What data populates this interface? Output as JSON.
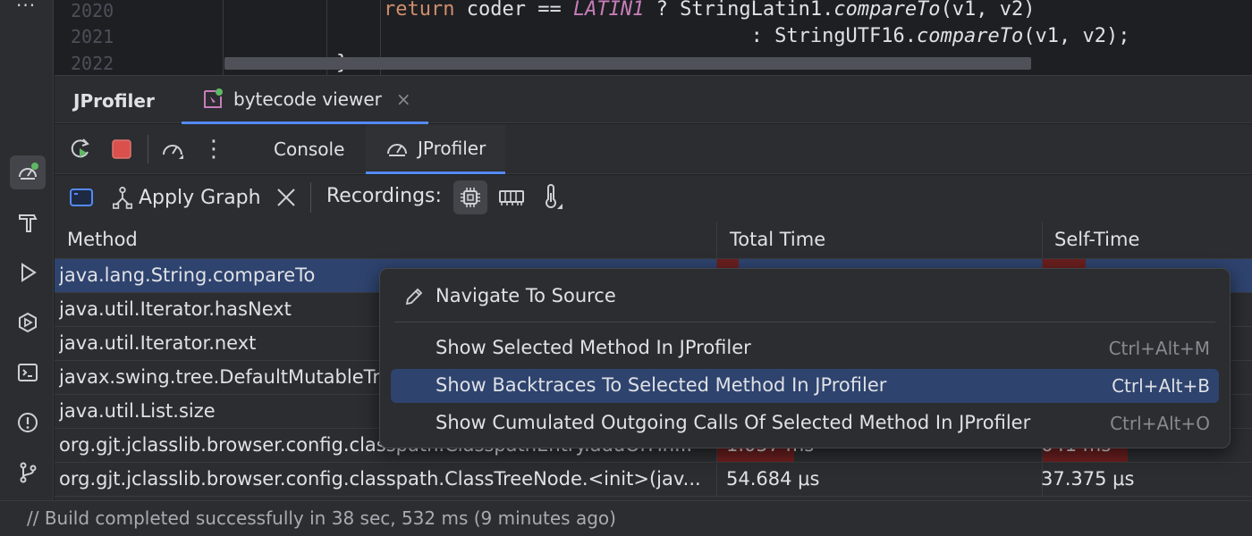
{
  "editor": {
    "lines": [
      {
        "number": "2020",
        "indent": "        ",
        "keyword": "return",
        "rest1": " coder == ",
        "const": "LATIN1",
        "rest2": " ? StringLatin1.",
        "fn": "compareTo",
        "rest3": "(v1, v2)"
      },
      {
        "number": "2021",
        "rest1": "                               : StringUTF16.",
        "fn": "compareTo",
        "rest3": "(v1, v2);"
      },
      {
        "number": "2022",
        "rest1": "    }"
      }
    ]
  },
  "tool_window": {
    "title": "JProfiler",
    "tab_label": "bytecode viewer",
    "tab_close": "×"
  },
  "inner_toolbar": {
    "more": "⋮",
    "tabs": [
      {
        "label": "Console"
      },
      {
        "label": "JProfiler"
      }
    ]
  },
  "profiler_toolbar": {
    "apply_graph": "Apply Graph",
    "recordings_label": "Recordings:"
  },
  "table": {
    "columns": [
      "Method",
      "Total Time",
      "Self-Time"
    ],
    "rows": [
      {
        "method": "java.lang.String.compareTo",
        "total": "",
        "self": "",
        "total_fill": 0.07,
        "self_fill": 0.21
      },
      {
        "method": "java.util.Iterator.hasNext",
        "total": "",
        "self": "",
        "total_fill": 0,
        "self_fill": 0
      },
      {
        "method": "java.util.Iterator.next",
        "total": "",
        "self": "",
        "total_fill": 0,
        "self_fill": 0
      },
      {
        "method": "javax.swing.tree.DefaultMutableTr",
        "total": "",
        "self": "",
        "total_fill": 0,
        "self_fill": 0
      },
      {
        "method": "java.util.List.size",
        "total": "",
        "self": "",
        "total_fill": 0,
        "self_fill": 0
      },
      {
        "method": "org.gjt.jclasslib.browser.config.classpath.ClasspathEntry.addOrFin...",
        "total": "1.057 ms",
        "self": "641 ms",
        "total_fill": 0.24,
        "self_fill": 0.41
      },
      {
        "method": "org.gjt.jclasslib.browser.config.classpath.ClassTreeNode.<init>(jav...",
        "total": "54.684 μs",
        "self": "37.375 μs",
        "total_fill": 0,
        "self_fill": 0
      }
    ]
  },
  "context_menu": {
    "items": [
      {
        "label": "Navigate To Source",
        "shortcut": ""
      },
      {
        "label": "Show Selected Method In JProfiler",
        "shortcut": "Ctrl+Alt+M"
      },
      {
        "label": "Show Backtraces To Selected Method In JProfiler",
        "shortcut": "Ctrl+Alt+B"
      },
      {
        "label": "Show Cumulated Outgoing Calls Of Selected Method In JProfiler",
        "shortcut": "Ctrl+Alt+O"
      }
    ]
  },
  "status_bar": {
    "text": "// Build completed successfully in 38 sec, 532 ms (9 minutes ago)"
  },
  "colors": {
    "selection": "#2e436e",
    "accent": "#548af7",
    "bar": "#6b1f1f"
  },
  "icons": {
    "left_strip": [
      "more-icon",
      "profiler-icon",
      "build-hammer-icon",
      "run-icon",
      "services-icon",
      "terminal-icon",
      "problems-icon",
      "git-icon"
    ],
    "toolbar": [
      "rerun-icon",
      "stop-icon",
      "speedometer-icon",
      "more-vertical-icon"
    ],
    "profiler": [
      "window-icon",
      "apply-graph-icon",
      "close-icon",
      "cpu-icon",
      "memory-icon",
      "thermometer-icon"
    ],
    "menu": [
      "edit-pencil-icon"
    ]
  }
}
